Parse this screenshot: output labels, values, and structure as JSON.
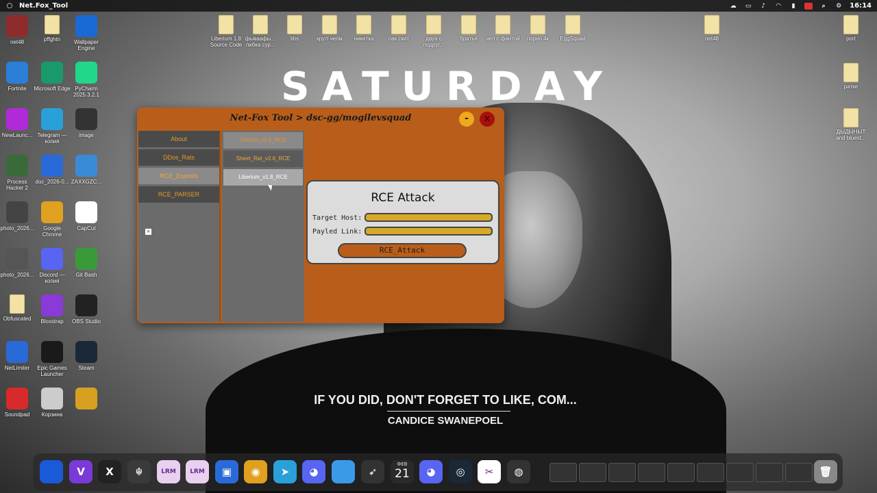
{
  "topbar": {
    "app_title": "Net.Fox_Tool",
    "clock": "16:14"
  },
  "desktop_left": [
    {
      "label": "net48",
      "icon": "winrar-icon",
      "color": "#8e2c2c"
    },
    {
      "label": "pffghtn",
      "icon": "folder-icon"
    },
    {
      "label": "Wallpaper Engine",
      "icon": "wallpaper-engine-icon",
      "color": "#1a6ad6"
    },
    {
      "label": "Fortnite",
      "icon": "fortnite-icon",
      "color": "#2a7fd8"
    },
    {
      "label": "Microsoft Edge",
      "icon": "edge-icon",
      "color": "#1a9a6a"
    },
    {
      "label": "PyCharm 2025.3.2.1",
      "icon": "pycharm-icon",
      "color": "#21d789"
    },
    {
      "label": "NewLaunc...",
      "icon": "launcher-icon",
      "color": "#b02ad8"
    },
    {
      "label": "Telegram — копия",
      "icon": "telegram-icon",
      "color": "#2aa0da"
    },
    {
      "label": "image",
      "icon": "image-file-icon",
      "color": "#333333"
    },
    {
      "label": "Process Hacker 2",
      "icon": "process-hacker-icon",
      "color": "#3a6a3a"
    },
    {
      "label": "doc_2026-0...",
      "icon": "video-file-icon",
      "color": "#2a6ad8"
    },
    {
      "label": "ZAXXGZC...",
      "icon": "installer-icon",
      "color": "#3a8ad8"
    },
    {
      "label": "photo_2026...",
      "icon": "photo-file-icon",
      "color": "#444444"
    },
    {
      "label": "Google Chrome",
      "icon": "chrome-icon",
      "color": "#e0a020"
    },
    {
      "label": "CapCut",
      "icon": "capcut-icon",
      "color": "#ffffff"
    },
    {
      "label": "photo_2026...",
      "icon": "photo-file-icon",
      "color": "#555555"
    },
    {
      "label": "Discord — копия",
      "icon": "discord-icon",
      "color": "#5865f2"
    },
    {
      "label": "Git Bash",
      "icon": "git-bash-icon",
      "color": "#3a9a3a"
    },
    {
      "label": "Obfuscated",
      "icon": "text-file-icon"
    },
    {
      "label": "Bloxstrap",
      "icon": "bloxstrap-icon",
      "color": "#8a3ad8"
    },
    {
      "label": "OBS Studio",
      "icon": "obs-icon",
      "color": "#222222"
    },
    {
      "label": "NetLimiter",
      "icon": "netlimiter-icon",
      "color": "#2a6ad8"
    },
    {
      "label": "Epic Games Launcher",
      "icon": "epic-games-icon",
      "color": "#1a1a1a"
    },
    {
      "label": "Steam",
      "icon": "steam-icon",
      "color": "#1b2838"
    },
    {
      "label": "Soundpad",
      "icon": "soundpad-icon",
      "color": "#d82a2a"
    },
    {
      "label": "Корзина",
      "icon": "recycle-bin-icon",
      "color": "#cccccc"
    },
    {
      "label": "",
      "icon": "game-icon",
      "color": "#d8a020"
    }
  ],
  "desktop_top": [
    {
      "label": "Liberium 1.8 Source Code",
      "icon": "archive-icon"
    },
    {
      "label": "фываафы... либка сур...",
      "icon": "archive-icon"
    },
    {
      "label": "libs",
      "icon": "folder-icon"
    },
    {
      "label": "круті челік",
      "icon": "folder-icon"
    },
    {
      "label": "никитка",
      "icon": "folder-icon"
    },
    {
      "label": "пак скит",
      "icon": "folder-icon"
    },
    {
      "label": "даун с подруг...",
      "icon": "folder-icon"
    },
    {
      "label": "братья",
      "icon": "folder-icon"
    },
    {
      "label": "чел с фантой",
      "icon": "folder-icon"
    },
    {
      "label": "порно 4к",
      "icon": "folder-icon"
    },
    {
      "label": "EggSquad",
      "icon": "archive-icon"
    },
    {
      "label": "net48",
      "icon": "archive-icon"
    },
    {
      "label": "port",
      "icon": "folder-icon"
    }
  ],
  "desktop_right": [
    {
      "label": "ратке",
      "icon": "archive-icon"
    },
    {
      "label": "ДЫДЫНЫТ and bluest...",
      "icon": "folder-icon"
    }
  ],
  "wallpaper": {
    "headline": "SATURDAY",
    "lyric": "IF YOU DID, DON'T FORGET TO LIKE, COM...",
    "author": "CANDICE SWANEPOEL"
  },
  "app": {
    "title": "Net-Fox Tool > dsc-gg/mogilevsquad",
    "min_label": "-",
    "close_label": "x",
    "nav": [
      {
        "label": "About",
        "active": false
      },
      {
        "label": "DDos_Rats",
        "active": false
      },
      {
        "label": "RCE_Exploits",
        "active": true
      },
      {
        "label": "RCE_PARSER",
        "active": false
      }
    ],
    "nav_checkbox": "×",
    "sub_items": [
      {
        "label": "XWorm_v5.6_RCE",
        "state": "first"
      },
      {
        "label": "Sheet_Rat_v2.6_RCE",
        "state": "normal"
      },
      {
        "label": "Liberium_v1.8_RCE",
        "state": "selected"
      }
    ],
    "panel": {
      "title": "RCE Attack",
      "target_label": "Target Host:",
      "target_value": "",
      "payload_label": "Payled Link:",
      "payload_value": "",
      "button_label": "RCE_Attack"
    }
  },
  "dock": {
    "date_month": "ФЕВ",
    "date_day": "21",
    "items": [
      {
        "name": "monitor-icon",
        "color": "#1a5ad8",
        "glyph": ""
      },
      {
        "name": "visual-studio-icon",
        "color": "#7a3ad8",
        "glyph": "V"
      },
      {
        "name": "x-icon",
        "color": "#222222",
        "glyph": "X"
      },
      {
        "name": "gold-dragon-icon",
        "color": "#3a3a3a",
        "glyph": "☬"
      },
      {
        "name": "lrm-icon",
        "color": "#e8d0f0",
        "glyph": "LRM"
      },
      {
        "name": "lrm-icon",
        "color": "#e8d0f0",
        "glyph": "LRM"
      },
      {
        "name": "window-icon",
        "color": "#2a6ad8",
        "glyph": "▣"
      },
      {
        "name": "chrome-icon",
        "color": "#e0a020",
        "glyph": "◉"
      },
      {
        "name": "telegram-icon",
        "color": "#2aa0da",
        "glyph": "➤"
      },
      {
        "name": "discord-icon",
        "color": "#5865f2",
        "glyph": "◕"
      },
      {
        "name": "folder-icon",
        "color": "#3a9ae8",
        "glyph": ""
      },
      {
        "name": "rocket-icon",
        "color": "#333333",
        "glyph": "➶"
      },
      {
        "name": "discord-icon",
        "color": "#5865f2",
        "glyph": "◕"
      },
      {
        "name": "steam-icon",
        "color": "#1b2838",
        "glyph": "◎"
      },
      {
        "name": "capcut-icon",
        "color": "#ffffff",
        "glyph": "✂"
      },
      {
        "name": "obs-icon",
        "color": "#333333",
        "glyph": "◍"
      },
      {
        "name": "trash-icon",
        "color": "#888888",
        "glyph": "🗑"
      }
    ]
  }
}
